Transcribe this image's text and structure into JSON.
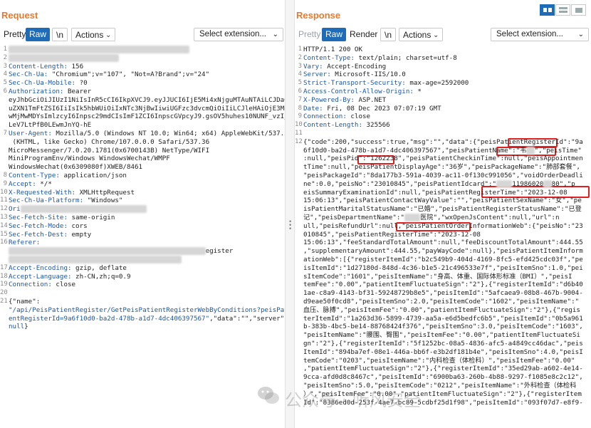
{
  "request": {
    "title": "Request",
    "toolbar": {
      "pretty": "Pretty",
      "raw": "Raw",
      "newline": "\\n",
      "actions": "Actions",
      "select_ext": "Select extension..."
    },
    "lines": [
      {
        "n": "1",
        "parts": [
          {
            "t": "blurred",
            "v": "██████████████████████████████████████████████"
          }
        ]
      },
      {
        "n": "2",
        "parts": [
          {
            "t": "blurred",
            "v": "████████████████████████████"
          }
        ]
      },
      {
        "n": "3",
        "parts": [
          {
            "t": "key",
            "v": "Content-Length: "
          },
          {
            "t": "text",
            "v": "156"
          }
        ]
      },
      {
        "n": "4",
        "parts": [
          {
            "t": "key",
            "v": "Sec-Ch-Ua: "
          },
          {
            "t": "text",
            "v": "\"Chromium\";v=\"107\", \"Not=A?Brand\";v=\"24\""
          }
        ]
      },
      {
        "n": "5",
        "parts": [
          {
            "t": "key",
            "v": "Sec-Ch-Ua-Mobile: "
          },
          {
            "t": "text",
            "v": "?0"
          }
        ]
      },
      {
        "n": "6",
        "parts": [
          {
            "t": "key",
            "v": "Authorization: "
          },
          {
            "t": "text",
            "v": "Bearer"
          }
        ]
      },
      {
        "n": "",
        "parts": [
          {
            "t": "text",
            "v": "eyJhbGciOiJIUzI1NiIsInR5cCI6IkpXVCJ9.eyJJUCI6IjE5Mi4xNjguMTAuNTAiLCJDaGl"
          }
        ]
      },
      {
        "n": "",
        "parts": [
          {
            "t": "text",
            "v": "uZXN1TmFtZSI6IiIsIk5hbWUiOiIxNTc3NjBwIiwiUGFzc3dvcmQiOiIiLCJleHAiOjE3MDI"
          }
        ]
      },
      {
        "n": "",
        "parts": [
          {
            "t": "text",
            "v": "wMjMwMDYsImlzcyI6Inpsc29mdCIsImF1ZCI6InpscGVpcyJ9.gsOV5huhes10NUNF_vzI_j"
          }
        ]
      },
      {
        "n": "",
        "parts": [
          {
            "t": "text",
            "v": "LeV7LtPfB0LEwmJnYQ-hE"
          }
        ]
      },
      {
        "n": "7",
        "parts": [
          {
            "t": "key",
            "v": "User-Agent: "
          },
          {
            "t": "text",
            "v": "Mozilla/5.0 (Windows NT 10.0; Win64; x64) AppleWebKit/537.36"
          }
        ]
      },
      {
        "n": "",
        "parts": [
          {
            "t": "text",
            "v": " (KHTML, like Gecko) Chrome/107.0.0.0 Safari/537.36"
          }
        ]
      },
      {
        "n": "",
        "parts": [
          {
            "t": "text",
            "v": "MicroMessenger/7.0.20.1781(0x6700143B) NetType/WIFI"
          }
        ]
      },
      {
        "n": "",
        "parts": [
          {
            "t": "text",
            "v": "MiniProgramEnv/Windows WindowsWechat/WMPF"
          }
        ]
      },
      {
        "n": "",
        "parts": [
          {
            "t": "text",
            "v": "WindowsWechat(0x6309080f)XWEB/8461"
          }
        ]
      },
      {
        "n": "8",
        "parts": [
          {
            "t": "key",
            "v": "Content-Type: "
          },
          {
            "t": "text",
            "v": "application/json"
          }
        ]
      },
      {
        "n": "9",
        "parts": [
          {
            "t": "key",
            "v": "Accept: "
          },
          {
            "t": "text",
            "v": "*/*"
          }
        ]
      },
      {
        "n": "10",
        "parts": [
          {
            "t": "key",
            "v": "X-Requested-With: "
          },
          {
            "t": "text",
            "v": "XMLHttpRequest"
          }
        ]
      },
      {
        "n": "11",
        "parts": [
          {
            "t": "key",
            "v": "Sec-Ch-Ua-Platform: "
          },
          {
            "t": "text",
            "v": "\"Windows\""
          }
        ]
      },
      {
        "n": "12",
        "parts": [
          {
            "t": "key",
            "v": "Ori"
          },
          {
            "t": "blurred",
            "v": "████████████████████████████████"
          }
        ]
      },
      {
        "n": "13",
        "parts": [
          {
            "t": "key",
            "v": "Sec-Fetch-Site: "
          },
          {
            "t": "text",
            "v": "same-origin"
          }
        ]
      },
      {
        "n": "14",
        "parts": [
          {
            "t": "key",
            "v": "Sec-Fetch-Mode: "
          },
          {
            "t": "text",
            "v": "cors"
          }
        ]
      },
      {
        "n": "15",
        "parts": [
          {
            "t": "key",
            "v": "Sec-Fetch-Dest: "
          },
          {
            "t": "text",
            "v": "empty"
          }
        ]
      },
      {
        "n": "16",
        "parts": [
          {
            "t": "key",
            "v": "Referer:"
          }
        ]
      },
      {
        "n": "",
        "parts": [
          {
            "t": "blurred",
            "v": "██████████████████████████████████████████████████"
          },
          {
            "t": "text",
            "v": "egister"
          }
        ]
      },
      {
        "n": "",
        "parts": [
          {
            "t": "blurred",
            "v": "████████████████████████████████████████████"
          }
        ]
      },
      {
        "n": "17",
        "parts": [
          {
            "t": "key",
            "v": "Accept-Encoding: "
          },
          {
            "t": "text",
            "v": "gzip, deflate"
          }
        ]
      },
      {
        "n": "18",
        "parts": [
          {
            "t": "key",
            "v": "Accept-Language: "
          },
          {
            "t": "text",
            "v": "zh-CN,zh;q=0.9"
          }
        ]
      },
      {
        "n": "19",
        "parts": [
          {
            "t": "key",
            "v": "Connection: "
          },
          {
            "t": "text",
            "v": "close"
          }
        ]
      },
      {
        "n": "20",
        "parts": []
      },
      {
        "n": "21",
        "parts": [
          {
            "t": "text",
            "v": "{\"name\":"
          }
        ]
      },
      {
        "n": "",
        "parts": [
          {
            "t": "str",
            "v": "\"/api/PeisPatientRegister/GetPeisPatientRegisterWebByConditions?peisPati"
          }
        ]
      },
      {
        "n": "",
        "parts": [
          {
            "t": "str",
            "v": "entRegisterId=9a6f10d0-ba2d-478b-a1d7-4dc406397567\""
          },
          {
            "t": "text",
            "v": ",\"data\":\"\",\"server\":"
          }
        ]
      },
      {
        "n": "",
        "parts": [
          {
            "t": "str",
            "v": "null"
          },
          {
            "t": "text",
            "v": "}"
          }
        ]
      }
    ]
  },
  "response": {
    "title": "Response",
    "toolbar": {
      "pretty": "Pretty",
      "raw": "Raw",
      "render": "Render",
      "newline": "\\n",
      "actions": "Actions",
      "select_ext": "Select extension..."
    },
    "lines": [
      {
        "n": "1",
        "parts": [
          {
            "t": "text",
            "v": "HTTP/1.1 200 OK"
          }
        ]
      },
      {
        "n": "2",
        "parts": [
          {
            "t": "key",
            "v": "Content-Type: "
          },
          {
            "t": "text",
            "v": "text/plain; charset=utf-8"
          }
        ]
      },
      {
        "n": "3",
        "parts": [
          {
            "t": "key",
            "v": "Vary: "
          },
          {
            "t": "text",
            "v": "Accept-Encoding"
          }
        ]
      },
      {
        "n": "4",
        "parts": [
          {
            "t": "key",
            "v": "Server: "
          },
          {
            "t": "text",
            "v": "Microsoft-IIS/10.0"
          }
        ]
      },
      {
        "n": "5",
        "parts": [
          {
            "t": "key",
            "v": "Strict-Transport-Security: "
          },
          {
            "t": "text",
            "v": "max-age=2592000"
          }
        ]
      },
      {
        "n": "6",
        "parts": [
          {
            "t": "key",
            "v": "Access-Control-Allow-Origin: "
          },
          {
            "t": "text",
            "v": "*"
          }
        ]
      },
      {
        "n": "7",
        "parts": [
          {
            "t": "key",
            "v": "X-Powered-By: "
          },
          {
            "t": "text",
            "v": "ASP.NET"
          }
        ]
      },
      {
        "n": "8",
        "parts": [
          {
            "t": "key",
            "v": "Date: "
          },
          {
            "t": "text",
            "v": "Fri, 08 Dec 2023 07:07:19 GMT"
          }
        ]
      },
      {
        "n": "9",
        "parts": [
          {
            "t": "key",
            "v": "Connection: "
          },
          {
            "t": "text",
            "v": "close"
          }
        ]
      },
      {
        "n": "10",
        "parts": [
          {
            "t": "key",
            "v": "Content-Length: "
          },
          {
            "t": "text",
            "v": "325566"
          }
        ]
      },
      {
        "n": "11",
        "parts": []
      },
      {
        "n": "12",
        "parts": [
          {
            "t": "text",
            "v": "{\"code\":200,\"success\":true,\"msg\":\"\",\"data\":{\"peisPatientRegisterId\":\"9a"
          }
        ]
      },
      {
        "n": "",
        "parts": [
          {
            "t": "text",
            "v": "6f10d0-ba2d-478b-a1d7-4dc406397567\",\"peisPatientName\":\"韦"
          },
          {
            "t": "blurred",
            "v": "██"
          },
          {
            "t": "text",
            "v": "\",\"peisTime\""
          }
        ]
      },
      {
        "n": "",
        "parts": [
          {
            "t": "text",
            "v": ":null,\"peisPid\":\"1262238\",\"peisPatientCheckinTime\":null,\"peisAppointmen"
          }
        ]
      },
      {
        "n": "",
        "parts": [
          {
            "t": "text",
            "v": "tTime\":null,\"peisPatientDisplayAge\":\"36岁\",\"peisPackageName\":\"肺部套餐\","
          }
        ]
      },
      {
        "n": "",
        "parts": [
          {
            "t": "text",
            "v": "\"peisPackageId\":\"8da177b3-591a-4039-ac11-0f130c991056\",\"voidOrderDeadli"
          }
        ]
      },
      {
        "n": "",
        "parts": [
          {
            "t": "text",
            "v": "ne\":0.0,\"peisNo\":\"23010845\",\"peisPatientIdcard\":\""
          },
          {
            "t": "blurred",
            "v": "████"
          },
          {
            "t": "text",
            "v": "11986020"
          },
          {
            "t": "blurred",
            "v": "██"
          },
          {
            "t": "text",
            "v": "80\",\"p"
          }
        ]
      },
      {
        "n": "",
        "parts": [
          {
            "t": "text",
            "v": "eisSummaryExaminationId\":null,\"peisPatientRegisterTime\":\"2023-12-08"
          }
        ]
      },
      {
        "n": "",
        "parts": [
          {
            "t": "text",
            "v": "15:06:13\",\"peisPatientContactWayValue\":\"\",\"peisPatientSexName\":\"女\",\"pe"
          }
        ]
      },
      {
        "n": "",
        "parts": [
          {
            "t": "text",
            "v": "isPatientMaritalStatusName\":\"已婚\",\"peisPatientRegisterStatusName\":\"已登"
          }
        ]
      },
      {
        "n": "",
        "parts": [
          {
            "t": "text",
            "v": "记\",\"peisDepartmentName\":\""
          },
          {
            "t": "blurred",
            "v": "████"
          },
          {
            "t": "text",
            "v": "医院\",\"wxOpenJsContent\":null,\"url\":n"
          }
        ]
      },
      {
        "n": "",
        "parts": [
          {
            "t": "text",
            "v": "ull,\"peisRefundUrl\":null,\"peisPatientOrderInformationWeb\":{\"peisNo\":\"23"
          }
        ]
      },
      {
        "n": "",
        "parts": [
          {
            "t": "text",
            "v": "010845\",\"peisPatientRegisterTime\":\"2023-12-08"
          }
        ]
      },
      {
        "n": "",
        "parts": [
          {
            "t": "text",
            "v": "15:06:13\",\"feeStandardTotalAmount\":null,\"feeDiscountTotalAmount\":444.55"
          }
        ]
      },
      {
        "n": "",
        "parts": [
          {
            "t": "text",
            "v": ",\"supplementaryAmount\":444.55,\"payWayCode\":null},\"peisPatientItemInform"
          }
        ]
      },
      {
        "n": "",
        "parts": [
          {
            "t": "text",
            "v": "ationWeb\":[{\"registerItemId\":\"b2c549b9-404d-4169-8fc5-efd425cdc03f\",\"pe"
          }
        ]
      },
      {
        "n": "",
        "parts": [
          {
            "t": "text",
            "v": "isItemId\":\"1d27180d-848d-4c36-b1e5-21c496533e7f\",\"peisItemSno\":1.0,\"pei"
          }
        ]
      },
      {
        "n": "",
        "parts": [
          {
            "t": "text",
            "v": "sItemCode\":\"1601\",\"peisItemName\":\"身高、体重、国际体形标准（BMI）\",\"peisI"
          }
        ]
      },
      {
        "n": "",
        "parts": [
          {
            "t": "text",
            "v": "temFee\":\"0.00\",\"patientItemFluctuateSign\":\"2\"},{\"registerItemId\":\"d6b40"
          }
        ]
      },
      {
        "n": "",
        "parts": [
          {
            "t": "text",
            "v": "1ae-c8a9-4143-bf31-59248729b8e5\",\"peisItemId\":\"5afcaea9-08b8-467b-9004-"
          }
        ]
      },
      {
        "n": "",
        "parts": [
          {
            "t": "text",
            "v": "d9eae50f0cd8\",\"peisItemSno\":2.0,\"peisItemCode\":\"1602\",\"peisItemName\":\""
          }
        ]
      },
      {
        "n": "",
        "parts": [
          {
            "t": "text",
            "v": "血压、脉搏\",\"peisItemFee\":\"0.00\",\"patientItemFluctuateSign\":\"2\"},{\"regis"
          }
        ]
      },
      {
        "n": "",
        "parts": [
          {
            "t": "text",
            "v": "terItemId\":\"1a263d36-5899-4739-aa5a-e6d5bedfc6b5\",\"peisItemId\":\"0b5a961"
          }
        ]
      },
      {
        "n": "",
        "parts": [
          {
            "t": "text",
            "v": "b-383b-4bc5-be14-88768424f376\",\"peisItemSno\":3.0,\"peisItemCode\":\"1603\","
          }
        ]
      },
      {
        "n": "",
        "parts": [
          {
            "t": "text",
            "v": "\"peisItemName\":\"腰围、臀围\",\"peisItemFee\":\"0.00\",\"patientItemFluctuateSi"
          }
        ]
      },
      {
        "n": "",
        "parts": [
          {
            "t": "text",
            "v": "gn\":\"2\"},{\"registerItemId\":\"5f1252bc-08a5-4836-afc5-a4849cc46dac\",\"peis"
          }
        ]
      },
      {
        "n": "",
        "parts": [
          {
            "t": "text",
            "v": "ItemId\":\"894ba7ef-08e1-446a-bb6f-e3b2df181b4e\",\"peisItemSno\":4.0,\"peisI"
          }
        ]
      },
      {
        "n": "",
        "parts": [
          {
            "t": "text",
            "v": "temCode\":\"0203\",\"peisItemName\":\"内科检查（体检科）\",\"peisItemFee\":\"0.00\""
          }
        ]
      },
      {
        "n": "",
        "parts": [
          {
            "t": "text",
            "v": ",\"patientItemFluctuateSign\":\"2\"},{\"registerItemId\":\"35ed29ab-a602-4e14-"
          }
        ]
      },
      {
        "n": "",
        "parts": [
          {
            "t": "text",
            "v": "9cca-afd0d8c8467c\",\"peisItemId\":\"6900ba63-260b-4b88-9297-f1085e8c2c12\","
          }
        ]
      },
      {
        "n": "",
        "parts": [
          {
            "t": "text",
            "v": "\"peisItemSno\":5.0,\"peisItemCode\":\"0212\",\"peisItemName\":\"外科检查（体检科"
          }
        ]
      },
      {
        "n": "",
        "parts": [
          {
            "t": "text",
            "v": "）\",\"peisItemFee\":\"0.00\",\"patientItemFluctuateSign\":\"2\"},{\"registerItem"
          }
        ]
      },
      {
        "n": "",
        "parts": [
          {
            "t": "text",
            "v": "Id\":\"8386ed0d-253f-4ae7-bc89-5cdbf25d1f98\",\"peisItemId\":\"093f07d7-e8f9-"
          }
        ]
      }
    ]
  },
  "watermark": {
    "text": "公众号 · 听风安全"
  }
}
